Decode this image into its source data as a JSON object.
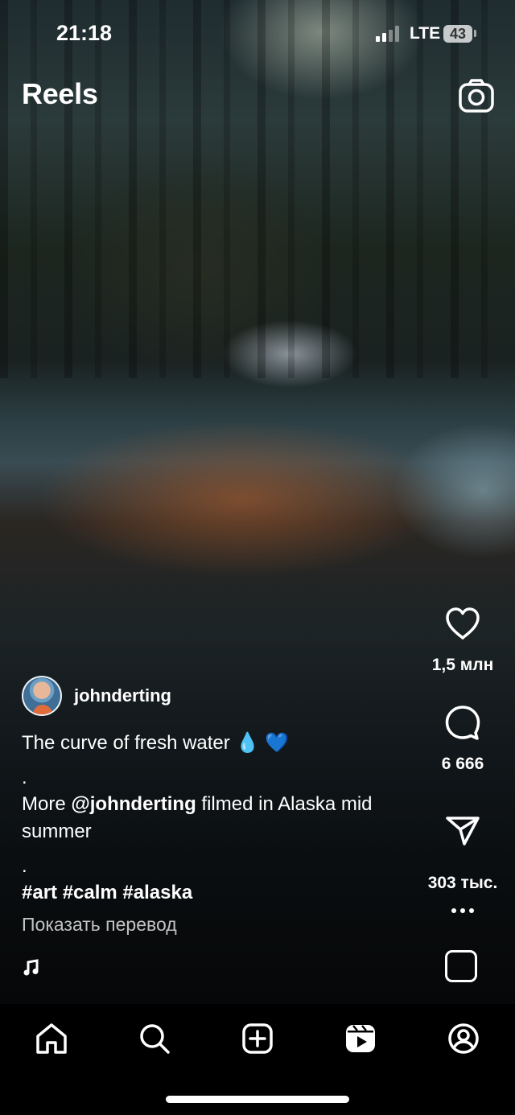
{
  "status_bar": {
    "time": "21:18",
    "network": "LTE",
    "battery": "43"
  },
  "header": {
    "title": "Reels",
    "camera_icon": "camera-icon"
  },
  "actions": {
    "likes": "1,5 млн",
    "comments": "6 666",
    "shares": "303 тыс."
  },
  "post": {
    "username": "johnderting",
    "caption_line1": "The curve of fresh water 💧 💙",
    "dot1": ".",
    "caption_more_prefix": "More ",
    "caption_mention": "@johnderting",
    "caption_more_suffix": " filmed in Alaska mid summer",
    "dot2": ".",
    "hashtags": "#art #calm #alaska",
    "translate": "Показать перевод"
  },
  "nav": {
    "items": [
      "home-icon",
      "search-icon",
      "create-icon",
      "reels-icon",
      "profile-icon"
    ],
    "active": "reels-icon"
  }
}
